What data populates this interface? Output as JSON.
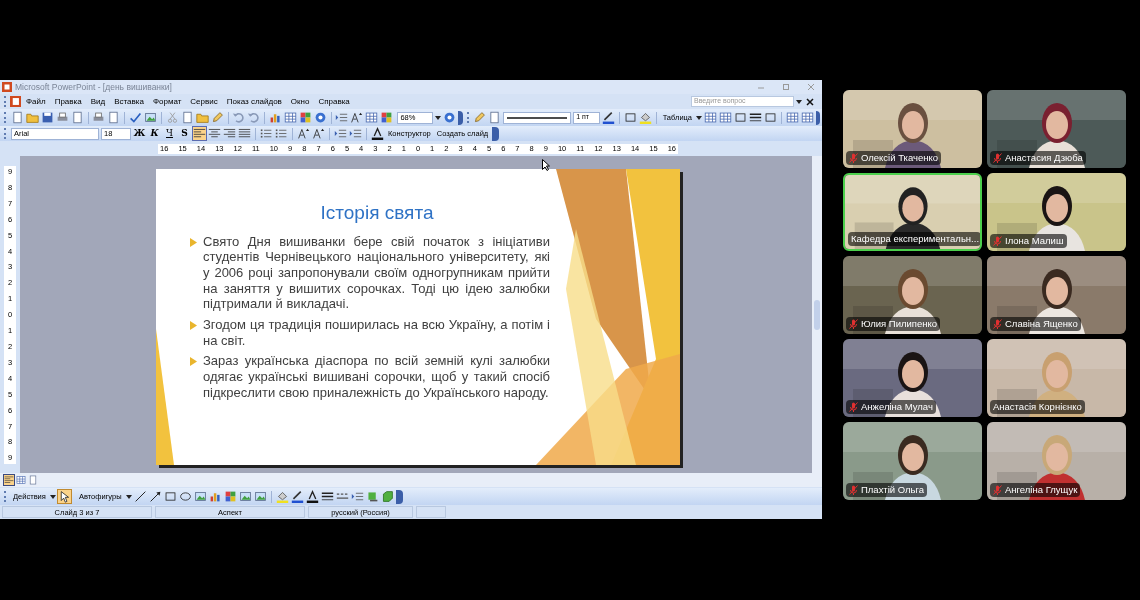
{
  "window": {
    "title": "Microsoft PowerPoint - [день вишиванки]"
  },
  "menu": [
    "Файл",
    "Правка",
    "Вид",
    "Вставка",
    "Формат",
    "Сервис",
    "Показ слайдов",
    "Окно",
    "Справка"
  ],
  "help_search": {
    "placeholder": "Введите вопрос"
  },
  "standard_toolbar": {
    "zoom": "68%",
    "line_weight": "1 пт",
    "table_menu": "Таблица"
  },
  "formatting_toolbar": {
    "font": "Arial",
    "size": "18",
    "style_buttons": [
      "Ж",
      "К",
      "Ч",
      "S"
    ],
    "align_buttons": [
      {
        "selected": true
      },
      {
        "selected": false
      },
      {
        "selected": false
      },
      {
        "selected": false
      }
    ],
    "designer": "Конструктор",
    "new_slide": "Создать слайд"
  },
  "ruler": {
    "horizontal": [
      "16",
      "15",
      "14",
      "13",
      "12",
      "11",
      "10",
      "9",
      "8",
      "7",
      "6",
      "5",
      "4",
      "3",
      "2",
      "1",
      "0",
      "1",
      "2",
      "3",
      "4",
      "5",
      "6",
      "7",
      "8",
      "9",
      "10",
      "11",
      "12",
      "13",
      "14",
      "15",
      "16"
    ],
    "vertical": [
      "9",
      "8",
      "7",
      "6",
      "5",
      "4",
      "3",
      "2",
      "1",
      "0",
      "1",
      "2",
      "3",
      "4",
      "5",
      "6",
      "7",
      "8",
      "9"
    ]
  },
  "slide": {
    "title": "Історія свята",
    "bullets": [
      "Свято Дня вишиванки бере свій початок з ініціативи студентів Чернівецького національного університету, які у 2006 році запропонували своїм одногрупникам прийти на заняття у вишитих сорочках. Тоді цю ідею залюбки підтримали й викладачі.",
      "Згодом ця традиція поширилась на всю Україну, а потім і на світ.",
      "Зараз українська діаспора по всій земній кулі залюбки одягає українські вишивані сорочки, щоб у такий спосіб підкреслити свою приналежність до Українського народу."
    ]
  },
  "view_buttons": [
    {
      "selected": true
    },
    {
      "selected": false
    },
    {
      "selected": false
    }
  ],
  "drawing_toolbar": {
    "actions": "Действия",
    "autoshapes": "Автофигуры"
  },
  "status_bar": [
    "Слайд 3 из 7",
    "Аспект",
    "русский (Россия)"
  ],
  "participants": [
    {
      "name": "Олексій Ткаченко",
      "muted": true,
      "speaking": false
    },
    {
      "name": "Анастасия Дзюба",
      "muted": true,
      "speaking": false
    },
    {
      "name": "Кафедра експериментальн...",
      "muted": false,
      "speaking": true
    },
    {
      "name": "Ілона Малиш",
      "muted": true,
      "speaking": false
    },
    {
      "name": "Юлия Пилипенко",
      "muted": true,
      "speaking": false
    },
    {
      "name": "Славіна Ященко",
      "muted": true,
      "speaking": false
    },
    {
      "name": "Анжеліна Мулач",
      "muted": true,
      "speaking": false
    },
    {
      "name": "Анастасія Корнієнко",
      "muted": false,
      "speaking": false
    },
    {
      "name": "Плахтій Ольга",
      "muted": true,
      "speaking": false
    },
    {
      "name": "Ангеліна Глущук",
      "muted": true,
      "speaking": false
    }
  ]
}
